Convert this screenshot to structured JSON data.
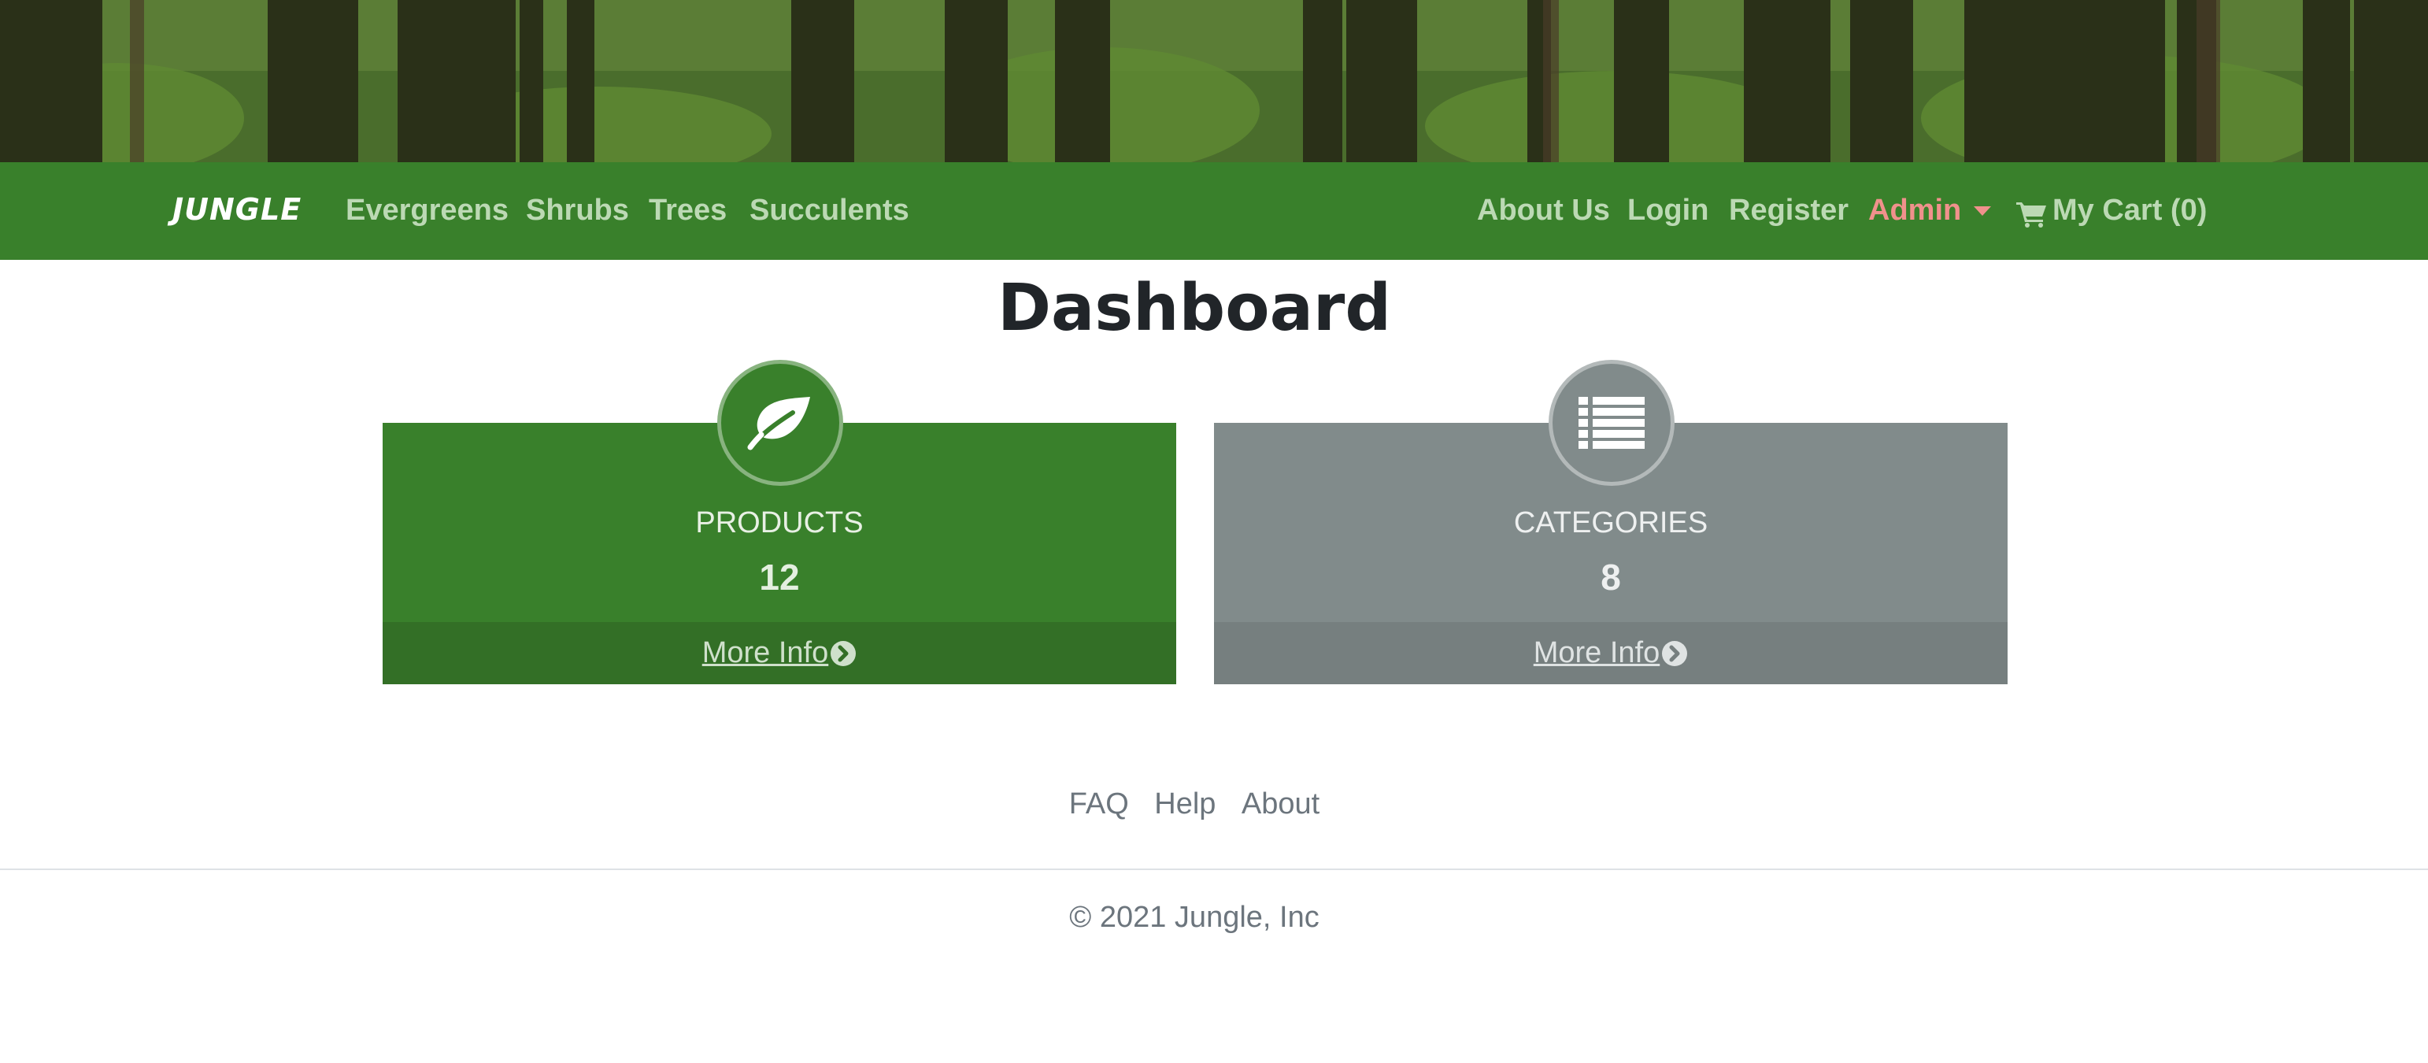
{
  "brand": "JUNGLE",
  "nav": {
    "left": [
      "Evergreens",
      "Shrubs",
      "Trees",
      "Succulents"
    ],
    "about": "About Us",
    "login": "Login",
    "register": "Register",
    "admin": "Admin",
    "cart": "My Cart (0)"
  },
  "page": {
    "title": "Dashboard"
  },
  "cards": {
    "products": {
      "label": "PRODUCTS",
      "count": "12",
      "more": "More Info",
      "icon": "leaf-icon"
    },
    "categories": {
      "label": "CATEGORIES",
      "count": "8",
      "more": "More Info",
      "icon": "list-icon"
    }
  },
  "footer": {
    "links": [
      "FAQ",
      "Help",
      "About"
    ],
    "copyright": "© 2021 Jungle, Inc"
  },
  "colors": {
    "navbar": "#39802b",
    "products_card": "#39802b",
    "categories_card": "#818b8b",
    "admin_accent": "#f0918c"
  }
}
